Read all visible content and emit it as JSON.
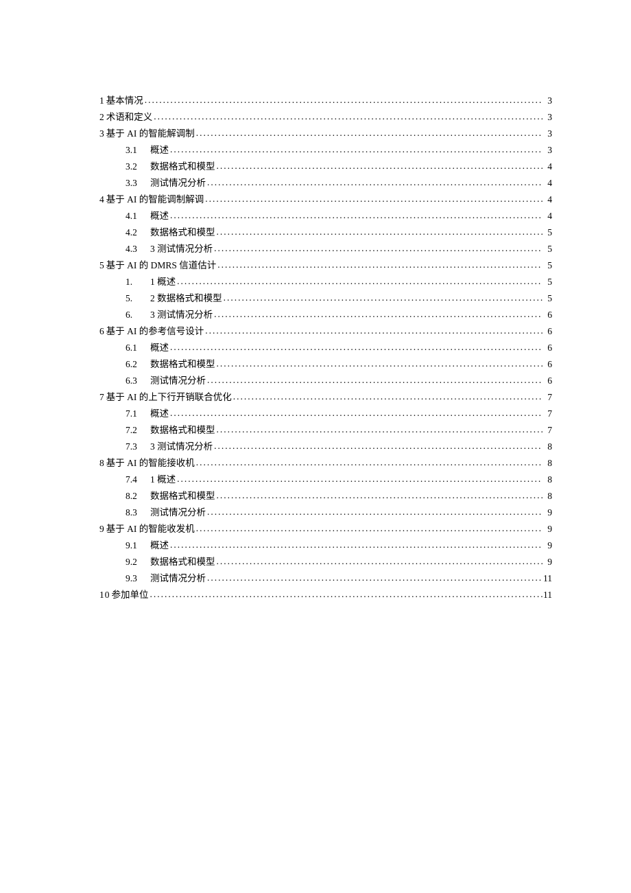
{
  "toc": [
    {
      "level": 1,
      "num": "1",
      "title": "基本情况",
      "page": "3"
    },
    {
      "level": 1,
      "num": "2",
      "title": "术语和定义",
      "page": "3"
    },
    {
      "level": 1,
      "num": "3",
      "title": "基于 AI 的智能解调制",
      "page": "3"
    },
    {
      "level": 2,
      "num": "3.1",
      "title": "概述",
      "page": "3"
    },
    {
      "level": 2,
      "num": "3.2",
      "title": "数据格式和模型",
      "page": "4"
    },
    {
      "level": 2,
      "num": "3.3",
      "title": "测试情况分析",
      "page": "4"
    },
    {
      "level": 1,
      "num": "4",
      "title": "基于 AI 的智能调制解调",
      "page": "4"
    },
    {
      "level": 2,
      "num": "4.1",
      "title": "概述",
      "page": "4"
    },
    {
      "level": 2,
      "num": "4.2",
      "title": "数据格式和模型",
      "page": "5"
    },
    {
      "level": 2,
      "num": "4.3",
      "title": "3 测试情况分析",
      "page": "5"
    },
    {
      "level": 1,
      "num": "5",
      "title": "基于 AI 的 DMRS 信道估计",
      "page": "5"
    },
    {
      "level": 2,
      "num": "1.",
      "title": "1 概述",
      "page": "5"
    },
    {
      "level": 2,
      "num": "5.",
      "title": "2 数据格式和模型",
      "page": "5"
    },
    {
      "level": 2,
      "num": "6.",
      "title": "3 测试情况分析",
      "page": "6"
    },
    {
      "level": 1,
      "num": "6",
      "title": "基于 AI 的参考信号设计",
      "page": "6"
    },
    {
      "level": 2,
      "num": "6.1",
      "title": "概述",
      "page": "6"
    },
    {
      "level": 2,
      "num": "6.2",
      "title": "数据格式和模型",
      "page": "6"
    },
    {
      "level": 2,
      "num": "6.3",
      "title": "测试情况分析",
      "page": "6"
    },
    {
      "level": 1,
      "num": "7",
      "title": "基于 AI 的上下行开销联合优化",
      "page": "7"
    },
    {
      "level": 2,
      "num": "7.1",
      "title": "概述",
      "page": "7"
    },
    {
      "level": 2,
      "num": "7.2",
      "title": "数据格式和模型",
      "page": "7"
    },
    {
      "level": 2,
      "num": "7.3",
      "title": "3 测试情况分析",
      "page": "8"
    },
    {
      "level": 1,
      "num": "8",
      "title": "基于 AI 的智能接收机",
      "page": "8"
    },
    {
      "level": 2,
      "num": "7.4",
      "title": "1 概述",
      "page": "8"
    },
    {
      "level": 2,
      "num": "8.2",
      "title": "数据格式和模型",
      "page": "8"
    },
    {
      "level": 2,
      "num": "8.3",
      "title": "测试情况分析",
      "page": "9"
    },
    {
      "level": 1,
      "num": "9",
      "title": "基于 AI 的智能收发机",
      "page": "9"
    },
    {
      "level": 2,
      "num": "9.1",
      "title": "概述",
      "page": "9"
    },
    {
      "level": 2,
      "num": "9.2",
      "title": "数据格式和模型",
      "page": "9"
    },
    {
      "level": 2,
      "num": "9.3",
      "title": "测试情况分析",
      "page": "11"
    },
    {
      "level": 1,
      "num": "10",
      "title": "参加单位",
      "page": "11"
    }
  ]
}
